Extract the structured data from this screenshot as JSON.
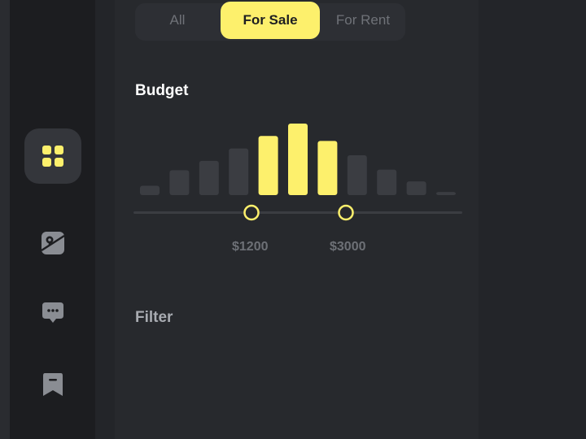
{
  "tabs": [
    {
      "label": "All",
      "selected": false
    },
    {
      "label": "For Sale",
      "selected": true
    },
    {
      "label": "For Rent",
      "selected": false
    }
  ],
  "budget": {
    "title": "Budget",
    "price_min_label": "$1200",
    "price_max_label": "$3000"
  },
  "filter": {
    "title": "Filter"
  },
  "sidebar": {
    "items": [
      {
        "icon": "grid-icon",
        "active": true
      },
      {
        "icon": "image-map-icon",
        "active": false
      },
      {
        "icon": "chat-icon",
        "active": false
      },
      {
        "icon": "bookmark-icon",
        "active": false
      }
    ]
  },
  "chart_data": {
    "type": "bar",
    "values": [
      1.5,
      4,
      5.5,
      7.5,
      9.5,
      11.5,
      8.7,
      6.4,
      4.1,
      2.2,
      0.5
    ],
    "selected_range_indices": [
      4,
      6
    ],
    "colors": {
      "selected": "#fdf06c",
      "unselected": "#3b3d42",
      "track": "#3b3d42",
      "accent": "#fdf06c"
    }
  }
}
